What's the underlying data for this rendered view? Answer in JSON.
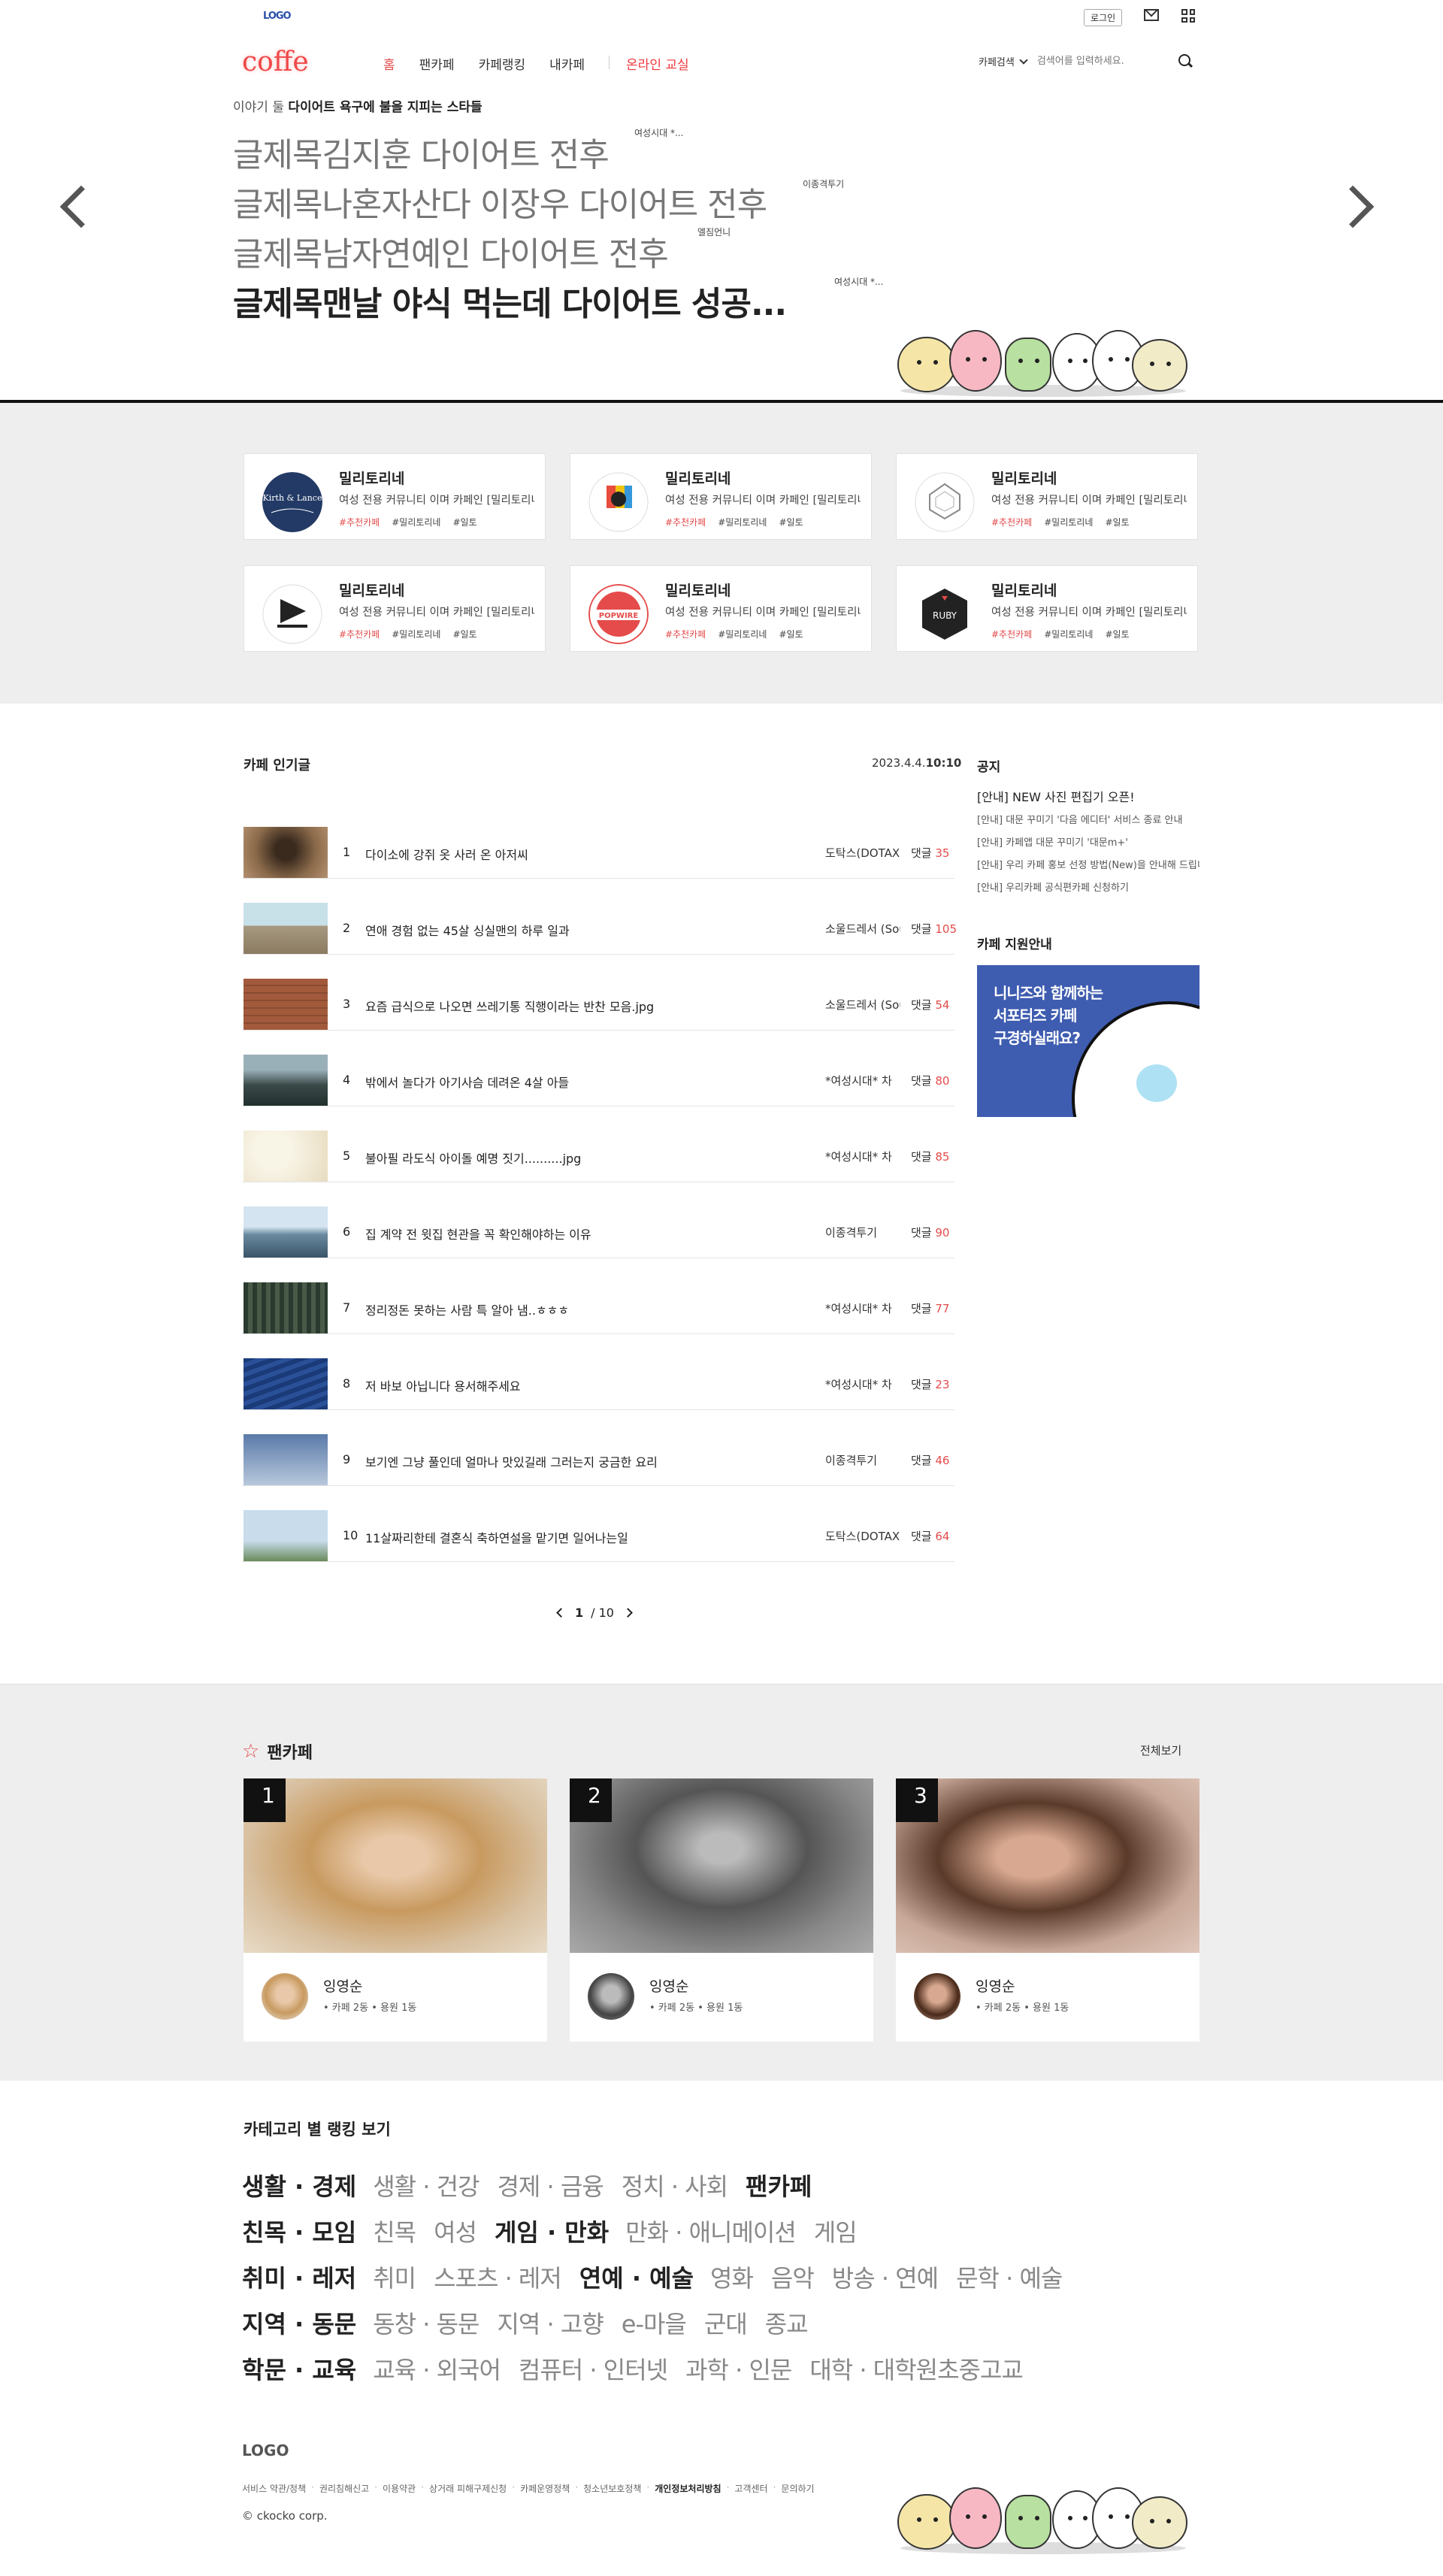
{
  "header": {
    "logo": "LOGO",
    "login": "로그인",
    "brand": "coffe",
    "nav": [
      "홈",
      "팬카페",
      "카페랭킹",
      "내카페"
    ],
    "nav_extra": "온라인 교실",
    "search_scope": "카페검색",
    "search_placeholder": "검색어를 입력하세요."
  },
  "hero": {
    "subtitle_prefix": "이야기 둘",
    "subtitle_bold": "다이어트 욕구에 불을 지피는 스타들",
    "headlines": [
      {
        "text": "글제목김지훈 다이어트 전후",
        "tag": "여성시대 *..."
      },
      {
        "text": "글제목나혼자산다 이장우 다이어트 전후",
        "tag": "이종격투기"
      },
      {
        "text": "글제목남자연예인 다이어트 전후",
        "tag": "엘짐언니"
      },
      {
        "text": "글제목맨날 야식 먹는데 다이어트 성공...",
        "tag": "여성시대 *..."
      }
    ]
  },
  "cafes": [
    {
      "title": "밀리토리네",
      "desc": "여성 전용 커뮤니티 이며 카페인 [밀리토리네]",
      "tags": [
        "#추천카페",
        "#밀리토리네",
        "#일토"
      ],
      "logo": "kirth-lance"
    },
    {
      "title": "밀리토리네",
      "desc": "여성 전용 커뮤니티 이며 카페인 [밀리토리네]",
      "tags": [
        "#추천카페",
        "#밀리토리네",
        "#일토"
      ],
      "logo": "colorful-studio"
    },
    {
      "title": "밀리토리네",
      "desc": "여성 전용 커뮤니티 이며 카페인 [밀리토리네]",
      "tags": [
        "#추천카페",
        "#밀리토리네",
        "#일토"
      ],
      "logo": "space"
    },
    {
      "title": "밀리토리네",
      "desc": "여성 전용 커뮤니티 이며 카페인 [밀리토리네]",
      "tags": [
        "#추천카페",
        "#밀리토리네",
        "#일토"
      ],
      "logo": "neverline"
    },
    {
      "title": "밀리토리네",
      "desc": "여성 전용 커뮤니티 이며 카페인 [밀리토리네]",
      "tags": [
        "#추천카페",
        "#밀리토리네",
        "#일토"
      ],
      "logo": "popwire"
    },
    {
      "title": "밀리토리네",
      "desc": "여성 전용 커뮤니티 이며 카페인 [밀리토리네]",
      "tags": [
        "#추천카페",
        "#밀리토리네",
        "#일토"
      ],
      "logo": "ruby"
    }
  ],
  "popular": {
    "title": "카페 인기글",
    "date": "2023.4.4.",
    "time": "10:10",
    "comment_label": "댓글",
    "posts": [
      {
        "num": "1",
        "title": "다이소에 강쥐 옷 사러 온 아저씨",
        "author": "도탁스(DOTAX)",
        "comments": "35"
      },
      {
        "num": "2",
        "title": "연애 경험 없는 45살 싱실맨의 하루 일과",
        "author": "소울드레서 (Soul)",
        "comments": "105"
      },
      {
        "num": "3",
        "title": "요즘 급식으로 나오면 쓰레기통 직행이라는 반찬 모음.jpg",
        "author": "소울드레서 (Soul)",
        "comments": "54"
      },
      {
        "num": "4",
        "title": "밖에서 놀다가 아기사슴 데려온 4살 아들",
        "author": "*여성시대* 차",
        "comments": "80"
      },
      {
        "num": "5",
        "title": "불아필 라도식 아이돌 예명 짓기..........jpg",
        "author": "*여성시대* 차",
        "comments": "85"
      },
      {
        "num": "6",
        "title": "집 계약 전 윗집 현관을 꼭 확인해야하는 이유",
        "author": "이종격투기",
        "comments": "90"
      },
      {
        "num": "7",
        "title": "정리정돈 못하는 사람 특 알아 냄..ㅎㅎㅎ",
        "author": "*여성시대* 차",
        "comments": "77"
      },
      {
        "num": "8",
        "title": "저 바보 아닙니다 용서해주세요",
        "author": "*여성시대* 차",
        "comments": "23"
      },
      {
        "num": "9",
        "title": "보기엔 그냥 풀인데 얼마나 맛있길래 그러는지 궁금한 요리",
        "author": "이종격투기",
        "comments": "46"
      },
      {
        "num": "10",
        "title": "11살짜리한테 결혼식 축하연설을 맡기면 일어나는일",
        "author": "도탁스(DOTAX)",
        "comments": "64"
      }
    ],
    "pager": {
      "current": "1",
      "total": "/ 10"
    }
  },
  "notice": {
    "title": "공지",
    "items": [
      "[안내] NEW 사진 편집기 오픈!",
      "[안내] 대문 꾸미기 '다음 에디터' 서비스 종료 안내",
      "[안내] 카페앱 대문 꾸미기 '대문m+'",
      "[안내] 우리 카페 홍보 선정 방법(New)을 안내해 드립니다",
      "[안내] 우리카페 공식편카페 신청하기"
    ],
    "support_title": "카페 지원안내",
    "banner_lines": [
      "니니즈와 함께하는",
      "서포터즈 카페",
      "구경하실래요?"
    ]
  },
  "fancafe": {
    "title": "팬카페",
    "view_all": "전체보기",
    "items": [
      {
        "rank": "1",
        "name": "잉영순",
        "stats": "• 카페 2동  • 용원 1동"
      },
      {
        "rank": "2",
        "name": "잉영순",
        "stats": "• 카페 2동  • 용원 1동"
      },
      {
        "rank": "3",
        "name": "잉영순",
        "stats": "• 카페 2동  • 용원 1동"
      }
    ]
  },
  "categories": {
    "title": "카테고리 별 랭킹 보기",
    "rows": [
      [
        {
          "t": "생활 · 경제",
          "b": true
        },
        {
          "t": "생활 · 건강",
          "b": false
        },
        {
          "t": "경제 · 금융",
          "b": false
        },
        {
          "t": "정치 · 사회",
          "b": false
        },
        {
          "t": "팬카페",
          "b": true
        }
      ],
      [
        {
          "t": "친목 · 모임",
          "b": true
        },
        {
          "t": "친목",
          "b": false
        },
        {
          "t": "여성",
          "b": false
        },
        {
          "t": "게임 · 만화",
          "b": true
        },
        {
          "t": "만화 · 애니메이션",
          "b": false
        },
        {
          "t": "게임",
          "b": false
        }
      ],
      [
        {
          "t": "취미 · 레저",
          "b": true
        },
        {
          "t": "취미",
          "b": false
        },
        {
          "t": "스포츠 · 레저",
          "b": false
        },
        {
          "t": "연예 · 예술",
          "b": true
        },
        {
          "t": "영화",
          "b": false
        },
        {
          "t": "음악",
          "b": false
        },
        {
          "t": "방송 · 연예",
          "b": false
        },
        {
          "t": "문학 · 예술",
          "b": false
        }
      ],
      [
        {
          "t": "지역 · 동문",
          "b": true
        },
        {
          "t": "동창 · 동문",
          "b": false
        },
        {
          "t": "지역 · 고향",
          "b": false
        },
        {
          "t": "e-마을",
          "b": false
        },
        {
          "t": "군대",
          "b": false
        },
        {
          "t": "종교",
          "b": false
        }
      ],
      [
        {
          "t": "학문 · 교육",
          "b": true
        },
        {
          "t": "교육 · 외국어",
          "b": false
        },
        {
          "t": "컴퓨터 · 인터넷",
          "b": false
        },
        {
          "t": "과학 · 인문",
          "b": false
        },
        {
          "t": "대학 · 대학원초중고교",
          "b": false
        }
      ]
    ]
  },
  "footer": {
    "logo": "LOGO",
    "links": [
      "서비스 약관/정책",
      "권리침해신고",
      "이용약관",
      "상거래 피해구제신청",
      "카페운영정책",
      "청소년보호정책",
      "개인정보처리방침",
      "고객센터",
      "문의하기"
    ],
    "bold_link_index": 6,
    "copyright": "© ckocko corp."
  },
  "colors": {
    "accent": "#e54b4b",
    "banner": "#3e5cb0",
    "gray_bg": "#eeeeee"
  }
}
